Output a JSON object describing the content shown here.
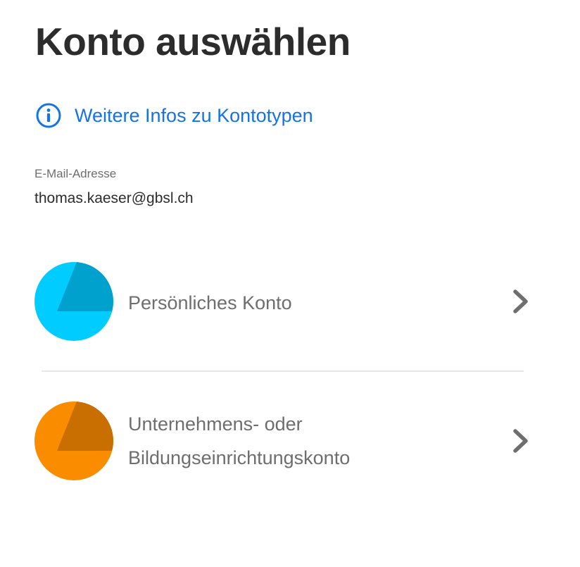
{
  "header": {
    "title": "Konto auswählen"
  },
  "info_link": {
    "label": "Weitere Infos zu Kontotypen",
    "icon": "info-icon"
  },
  "email": {
    "label": "E-Mail-Adresse",
    "value": "thomas.kaeser@gbsl.ch"
  },
  "accounts": [
    {
      "label_lines": [
        "Persönliches Konto"
      ],
      "icon": "chevron-right-icon",
      "colors": {
        "primary": "#00ccff",
        "secondary": "#00a1cc"
      }
    },
    {
      "label_lines": [
        "Unternehmens- oder",
        "Bildungseinrichtungskonto"
      ],
      "icon": "chevron-right-icon",
      "colors": {
        "primary": "#fa8c00",
        "secondary": "#c96e00"
      }
    }
  ],
  "colors": {
    "link": "#1473e6",
    "title": "#2c2c2c",
    "muted": "#6e6e6e",
    "chevron": "#6e6e6e",
    "divider": "#e8e8e8"
  }
}
